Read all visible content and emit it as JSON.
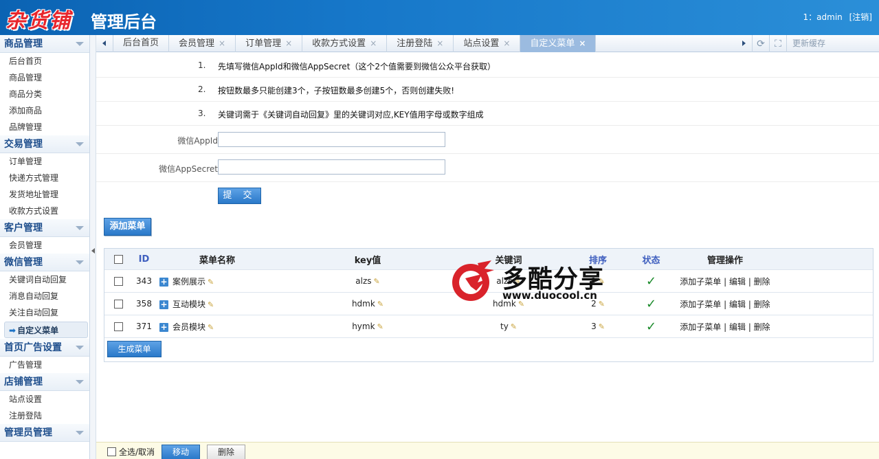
{
  "header": {
    "logo": "杂货铺",
    "title": "管理后台",
    "user": "1：admin",
    "logout": "[注销]"
  },
  "sidebar": {
    "groups": [
      {
        "title": "商品管理",
        "items": [
          "后台首页",
          "商品管理",
          "商品分类",
          "添加商品",
          "品牌管理"
        ]
      },
      {
        "title": "交易管理",
        "items": [
          "订单管理",
          "快递方式管理",
          "发货地址管理",
          "收款方式设置"
        ]
      },
      {
        "title": "客户管理",
        "items": [
          "会员管理"
        ]
      },
      {
        "title": "微信管理",
        "items": [
          "关键词自动回复",
          "消息自动回复",
          "关注自动回复",
          "自定义菜单"
        ]
      },
      {
        "title": "首页广告设置",
        "items": [
          "广告管理"
        ]
      },
      {
        "title": "店铺管理",
        "items": [
          "站点设置",
          "注册登陆"
        ]
      },
      {
        "title": "管理员管理",
        "items": []
      }
    ],
    "active_item": "自定义菜单"
  },
  "tabs": {
    "items": [
      {
        "label": "后台首页",
        "closable": false
      },
      {
        "label": "会员管理",
        "closable": true
      },
      {
        "label": "订单管理",
        "closable": true
      },
      {
        "label": "收款方式设置",
        "closable": true
      },
      {
        "label": "注册登陆",
        "closable": true
      },
      {
        "label": "站点设置",
        "closable": true
      },
      {
        "label": "自定义菜单",
        "closable": true,
        "active": true
      }
    ],
    "close_glyph": "×",
    "clear_cache": "更新缓存"
  },
  "tips": [
    {
      "num": "1.",
      "text": "先填写微信AppId和微信AppSecret（这个2个值需要到微信公众平台获取）"
    },
    {
      "num": "2.",
      "text": "按钮数最多只能创建3个，子按钮数最多创建5个，否则创建失败!"
    },
    {
      "num": "3.",
      "text": "关键词需于《关键词自动回复》里的关键词对应,KEY值用字母或数字组成"
    }
  ],
  "form": {
    "appid_label": "微信AppId:",
    "appid_value": "",
    "appsecret_label": "微信AppSecret:",
    "appsecret_value": "",
    "submit_label": "提 交"
  },
  "add_menu_label": "添加菜单",
  "table": {
    "headers": {
      "id": "ID",
      "name": "菜单名称",
      "key": "key值",
      "keyword": "关键词",
      "sort": "排序",
      "state": "状态",
      "ops": "管理操作"
    },
    "rows": [
      {
        "id": "343",
        "name": "案例展示",
        "key": "alzs",
        "keyword": "alzs",
        "sort": "1",
        "state": "✓"
      },
      {
        "id": "358",
        "name": "互动模块",
        "key": "hdmk",
        "keyword": "hdmk",
        "sort": "2",
        "state": "✓"
      },
      {
        "id": "371",
        "name": "会员模块",
        "key": "hymk",
        "keyword": "ty",
        "sort": "3",
        "state": "✓"
      }
    ],
    "ops": {
      "add_child": "添加子菜单",
      "edit": "编辑",
      "delete": "删除",
      "sep": " | "
    },
    "generate_label": "生成菜单"
  },
  "watermark": {
    "text": "多酷分享",
    "url": "www.duocool.cn"
  },
  "footer": {
    "select_all": "全选/取消",
    "move": "移动",
    "delete": "删除"
  },
  "colors": {
    "header_bg": "#1677c9",
    "accent_blue": "#2a79c9",
    "active_tab": "#9bbbe0",
    "logo_red": "#e8262c"
  }
}
